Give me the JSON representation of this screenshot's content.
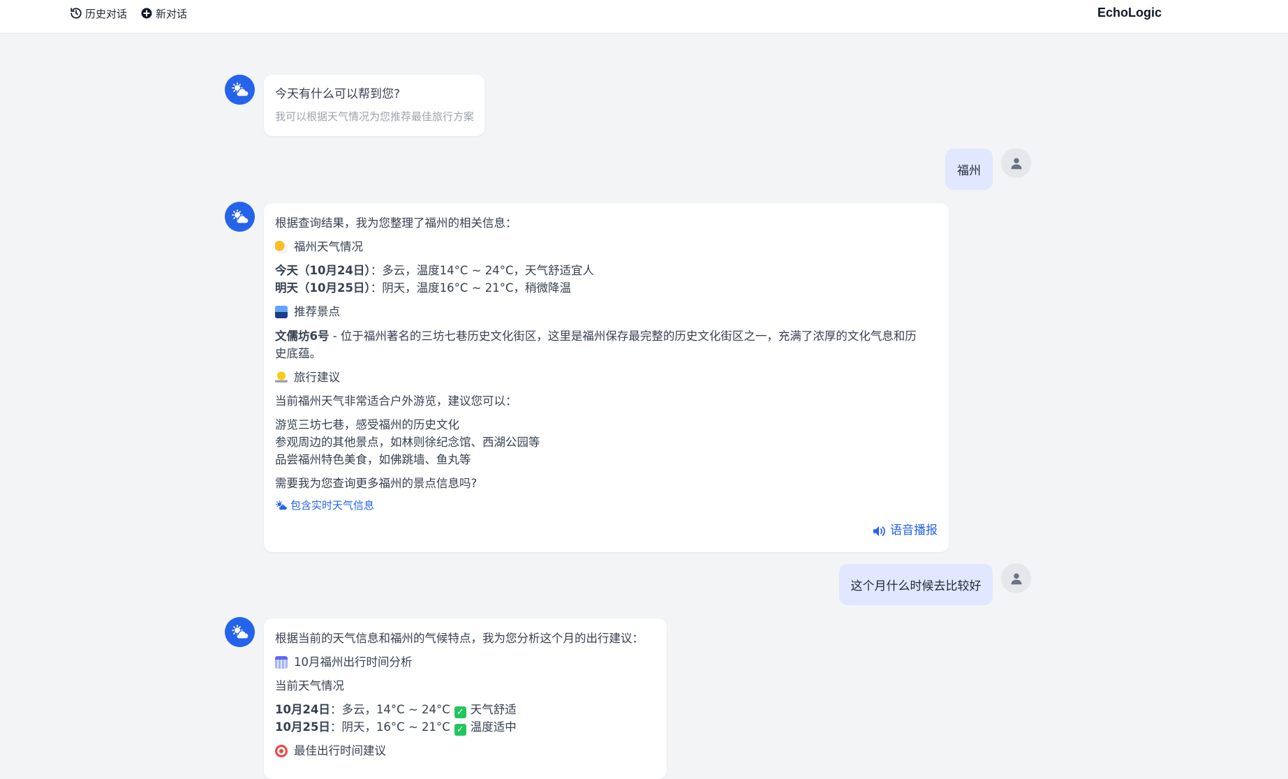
{
  "header": {
    "history_label": "历史对话",
    "new_chat_label": "新对话",
    "brand": "EchoLogic"
  },
  "messages": {
    "greeting": {
      "title": "今天有什么可以帮到您?",
      "subtitle": "我可以根据天气情况为您推荐最佳旅行方案"
    },
    "user1": {
      "text": "福州"
    },
    "bot1": {
      "intro": "根据查询结果，我为您整理了福州的相关信息：",
      "weather_heading": "福州天气情况",
      "today_label": "今天（10月24日）",
      "today_text": "：多云，温度14°C ~ 24°C，天气舒适宜人",
      "tomorrow_label": "明天（10月25日）",
      "tomorrow_text": "：阴天，温度16°C ~ 21°C，稍微降温",
      "spots_heading": "推荐景点",
      "spot_name": "文儒坊6号",
      "spot_desc_1": " - 位于福州著名的三坊七巷历史文化街区，这里是福州保存最完整的历史文化街区之一，充满了浓厚的文化气息和历",
      "spot_desc_2": "史底蕴。",
      "tips_heading": "旅行建议",
      "tips_intro": "当前福州天气非常适合户外游览，建议您可以：",
      "tip_1": "游览三坊七巷，感受福州的历史文化",
      "tip_2": "参观周边的其他景点，如林则徐纪念馆、西湖公园等",
      "tip_3": "品尝福州特色美食，如佛跳墙、鱼丸等",
      "closing": "需要我为您查询更多福州的景点信息吗?",
      "weather_tag": "包含实时天气信息",
      "voice_label": "语音播报"
    },
    "user2": {
      "text": "这个月什么时候去比较好"
    },
    "bot2": {
      "intro": "根据当前的天气信息和福州的气候特点，我为您分析这个月的出行建议：",
      "analysis_heading": "10月福州出行时间分析",
      "current_heading": "当前天气情况",
      "d1_label": "10月24日",
      "d1_text": "：多云，14°C ~ 24°C",
      "d1_tag": "天气舒适",
      "d2_label": "10月25日",
      "d2_text": "：阴天，16°C ~ 21°C",
      "d2_tag": "温度适中",
      "best_heading": "最佳出行时间建议"
    }
  },
  "colors": {
    "accent": "#2563eb",
    "user_bubble": "#e0e7ff",
    "background": "#f3f4f6"
  },
  "icons": {
    "history": "history-icon",
    "new_chat": "plus-circle-icon",
    "bot": "weather-cloud-sun-icon",
    "user": "user-icon",
    "voice": "speaker-icon"
  }
}
